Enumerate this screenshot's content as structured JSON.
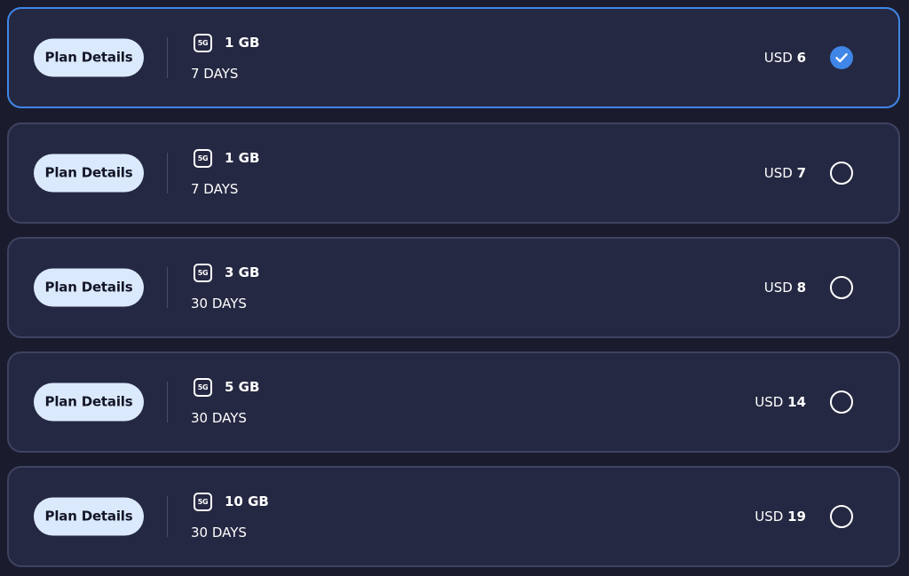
{
  "plans": [
    {
      "button_label": "Plan Details",
      "network_badge": "5G",
      "data": "1 GB",
      "duration": "7 DAYS",
      "currency": "USD",
      "price": "6",
      "selected": true
    },
    {
      "button_label": "Plan Details",
      "network_badge": "5G",
      "data": "1 GB",
      "duration": "7 DAYS",
      "currency": "USD",
      "price": "7",
      "selected": false
    },
    {
      "button_label": "Plan Details",
      "network_badge": "5G",
      "data": "3 GB",
      "duration": "30 DAYS",
      "currency": "USD",
      "price": "8",
      "selected": false
    },
    {
      "button_label": "Plan Details",
      "network_badge": "5G",
      "data": "5 GB",
      "duration": "30 DAYS",
      "currency": "USD",
      "price": "14",
      "selected": false
    },
    {
      "button_label": "Plan Details",
      "network_badge": "5G",
      "data": "10 GB",
      "duration": "30 DAYS",
      "currency": "USD",
      "price": "19",
      "selected": false
    }
  ],
  "icons": {
    "selected": "check-circle-icon",
    "unselected": "radio-empty-icon",
    "network": "5g-icon"
  },
  "colors": {
    "background": "#1a1c2e",
    "card": "#252842",
    "card_border": "#3f4260",
    "accent": "#3f86e6",
    "button_bg": "#dbe9fd"
  }
}
